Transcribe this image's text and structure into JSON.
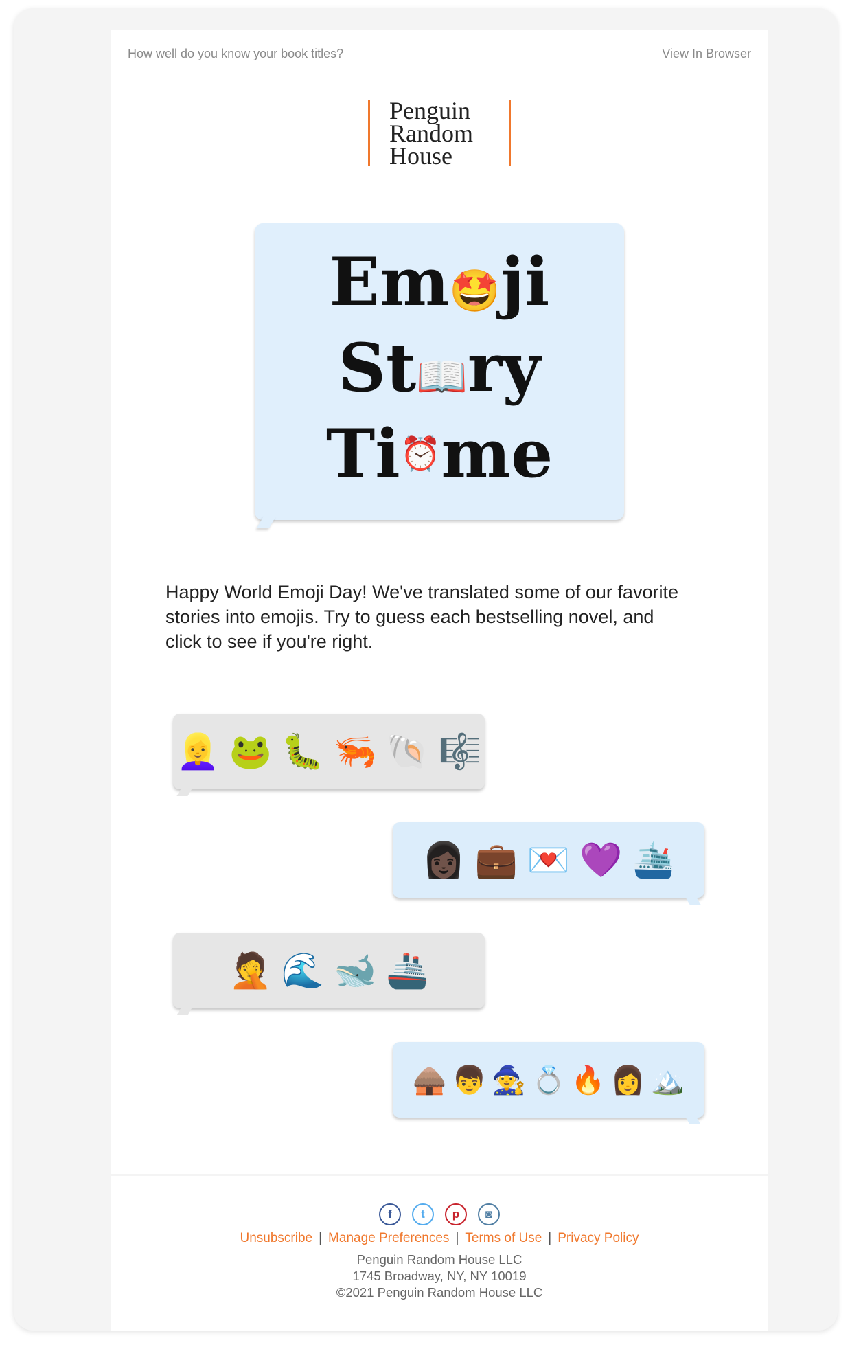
{
  "header": {
    "preheader": "How well do you know your book titles?",
    "view_in_browser": "View In Browser"
  },
  "logo": {
    "line1": "Penguin",
    "line2": "Random",
    "line3": "House"
  },
  "hero": {
    "line1_a": "Em",
    "line1_emoji": "🤩",
    "line1_b": "ji",
    "line2_a": "St",
    "line2_emoji": "📖",
    "line2_b": "ry",
    "line3_a": "Ti",
    "line3_emoji": "⏰",
    "line3_b": "me"
  },
  "intro": "Happy World Emoji Day! We've translated some of our favorite stories into emojis. Try to guess each bestselling novel, and click to see if you're right.",
  "puzzles": [
    {
      "style": "gray",
      "emojis": [
        "👱‍♀️",
        "🐸",
        "🐛",
        "🦐",
        "🐚",
        "🎼"
      ]
    },
    {
      "style": "blue",
      "emojis": [
        "👩🏿",
        "💼",
        "💌",
        "💜",
        "🛳️"
      ]
    },
    {
      "style": "gray",
      "emojis": [
        "🤦",
        "🌊",
        "🐋",
        "🚢"
      ]
    },
    {
      "style": "blue",
      "emojis": [
        "🛖",
        "👦",
        "🧙",
        "💍",
        "🔥",
        "👩",
        "🏔️"
      ]
    }
  ],
  "footer": {
    "social": [
      "facebook",
      "twitter",
      "pinterest",
      "instagram"
    ],
    "links": [
      "Unsubscribe",
      "Manage Preferences",
      "Terms of Use",
      "Privacy Policy"
    ],
    "company": "Penguin Random House LLC",
    "address": "1745 Broadway, NY, NY 10019",
    "copyright": "©2021 Penguin Random House LLC"
  },
  "colors": {
    "accent": "#f0782d",
    "gray_bubble": "#e6e6e6",
    "blue_bubble": "#dcedfb"
  }
}
